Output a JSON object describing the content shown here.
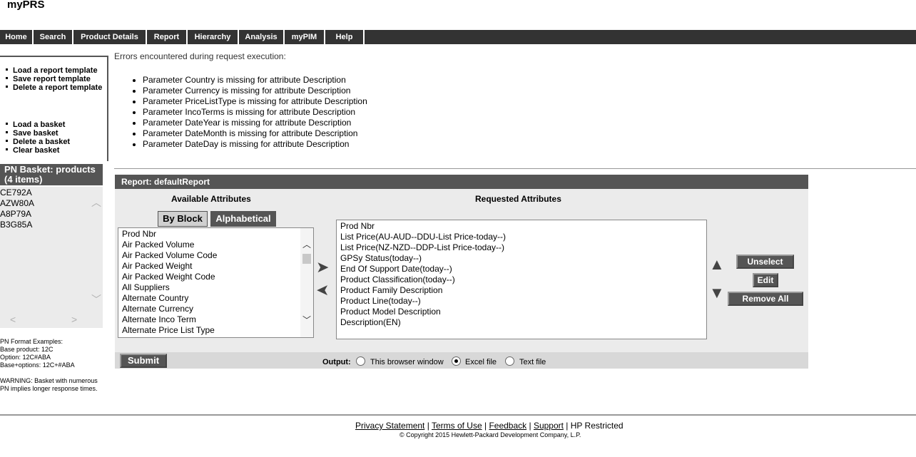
{
  "app": {
    "title": "myPRS"
  },
  "nav": [
    "Home",
    "Search",
    "Product Details",
    "Report",
    "Hierarchy",
    "Analysis",
    "myPIM",
    "Help"
  ],
  "sidebar": {
    "report_menu": [
      "Load a report template",
      "Save report template",
      "Delete a report template"
    ],
    "basket_menu": [
      "Load a basket",
      "Save basket",
      "Delete a basket",
      "Clear basket"
    ],
    "basket_header": "PN Basket: products (4 items)",
    "basket_items": [
      "CE792A",
      "AZW80A",
      "A8P79A",
      "B3G85A"
    ],
    "format_help": [
      "PN Format Examples:",
      "Base product: 12C",
      "Option: 12C#ABA",
      "Base+options: 12C+#ABA",
      "",
      "WARNING: Basket with numerous",
      "PN implies longer response times."
    ]
  },
  "errors": {
    "title": "Errors encountered during request execution:",
    "items": [
      "Parameter Country is missing for attribute Description",
      "Parameter Currency is missing for attribute Description",
      "Parameter PriceListType is missing for attribute Description",
      "Parameter IncoTerms is missing for attribute Description",
      "Parameter DateYear is missing for attribute Description",
      "Parameter DateMonth is missing for attribute Description",
      "Parameter DateDay is missing for attribute Description"
    ]
  },
  "report": {
    "header": "Report: defaultReport",
    "available_label": "Available Attributes",
    "requested_label": "Requested Attributes",
    "tabs": [
      {
        "label": "By Block",
        "active": false
      },
      {
        "label": "Alphabetical",
        "active": true
      }
    ],
    "available": [
      "Prod Nbr",
      "Air Packed Volume",
      "Air Packed Volume Code",
      "Air Packed Weight",
      "Air Packed Weight Code",
      "All Suppliers",
      "Alternate Country",
      "Alternate Currency",
      "Alternate Inco Term",
      "Alternate Price List Type"
    ],
    "requested": [
      "Prod Nbr",
      "List Price(AU-AUD--DDU-List Price-today--)",
      "List Price(NZ-NZD--DDP-List Price-today--)",
      "GPSy Status(today--)",
      "End Of Support Date(today--)",
      "Product Classification(today--)",
      "Product Family Description",
      "Product Line(today--)",
      "Product Model Description",
      "Description(EN)"
    ],
    "buttons": {
      "unselect": "Unselect",
      "edit": "Edit",
      "remove_all": "Remove All",
      "submit": "Submit"
    },
    "output": {
      "label": "Output:",
      "options": [
        {
          "label": "This browser window",
          "checked": false
        },
        {
          "label": "Excel file",
          "checked": true
        },
        {
          "label": "Text file",
          "checked": false
        }
      ]
    }
  },
  "footer": {
    "links": [
      "Privacy Statement",
      "Terms of Use",
      "Feedback",
      "Support"
    ],
    "restricted": "HP Restricted",
    "copyright": "© Copyright 2015 Hewlett-Packard Development Company, L.P."
  }
}
